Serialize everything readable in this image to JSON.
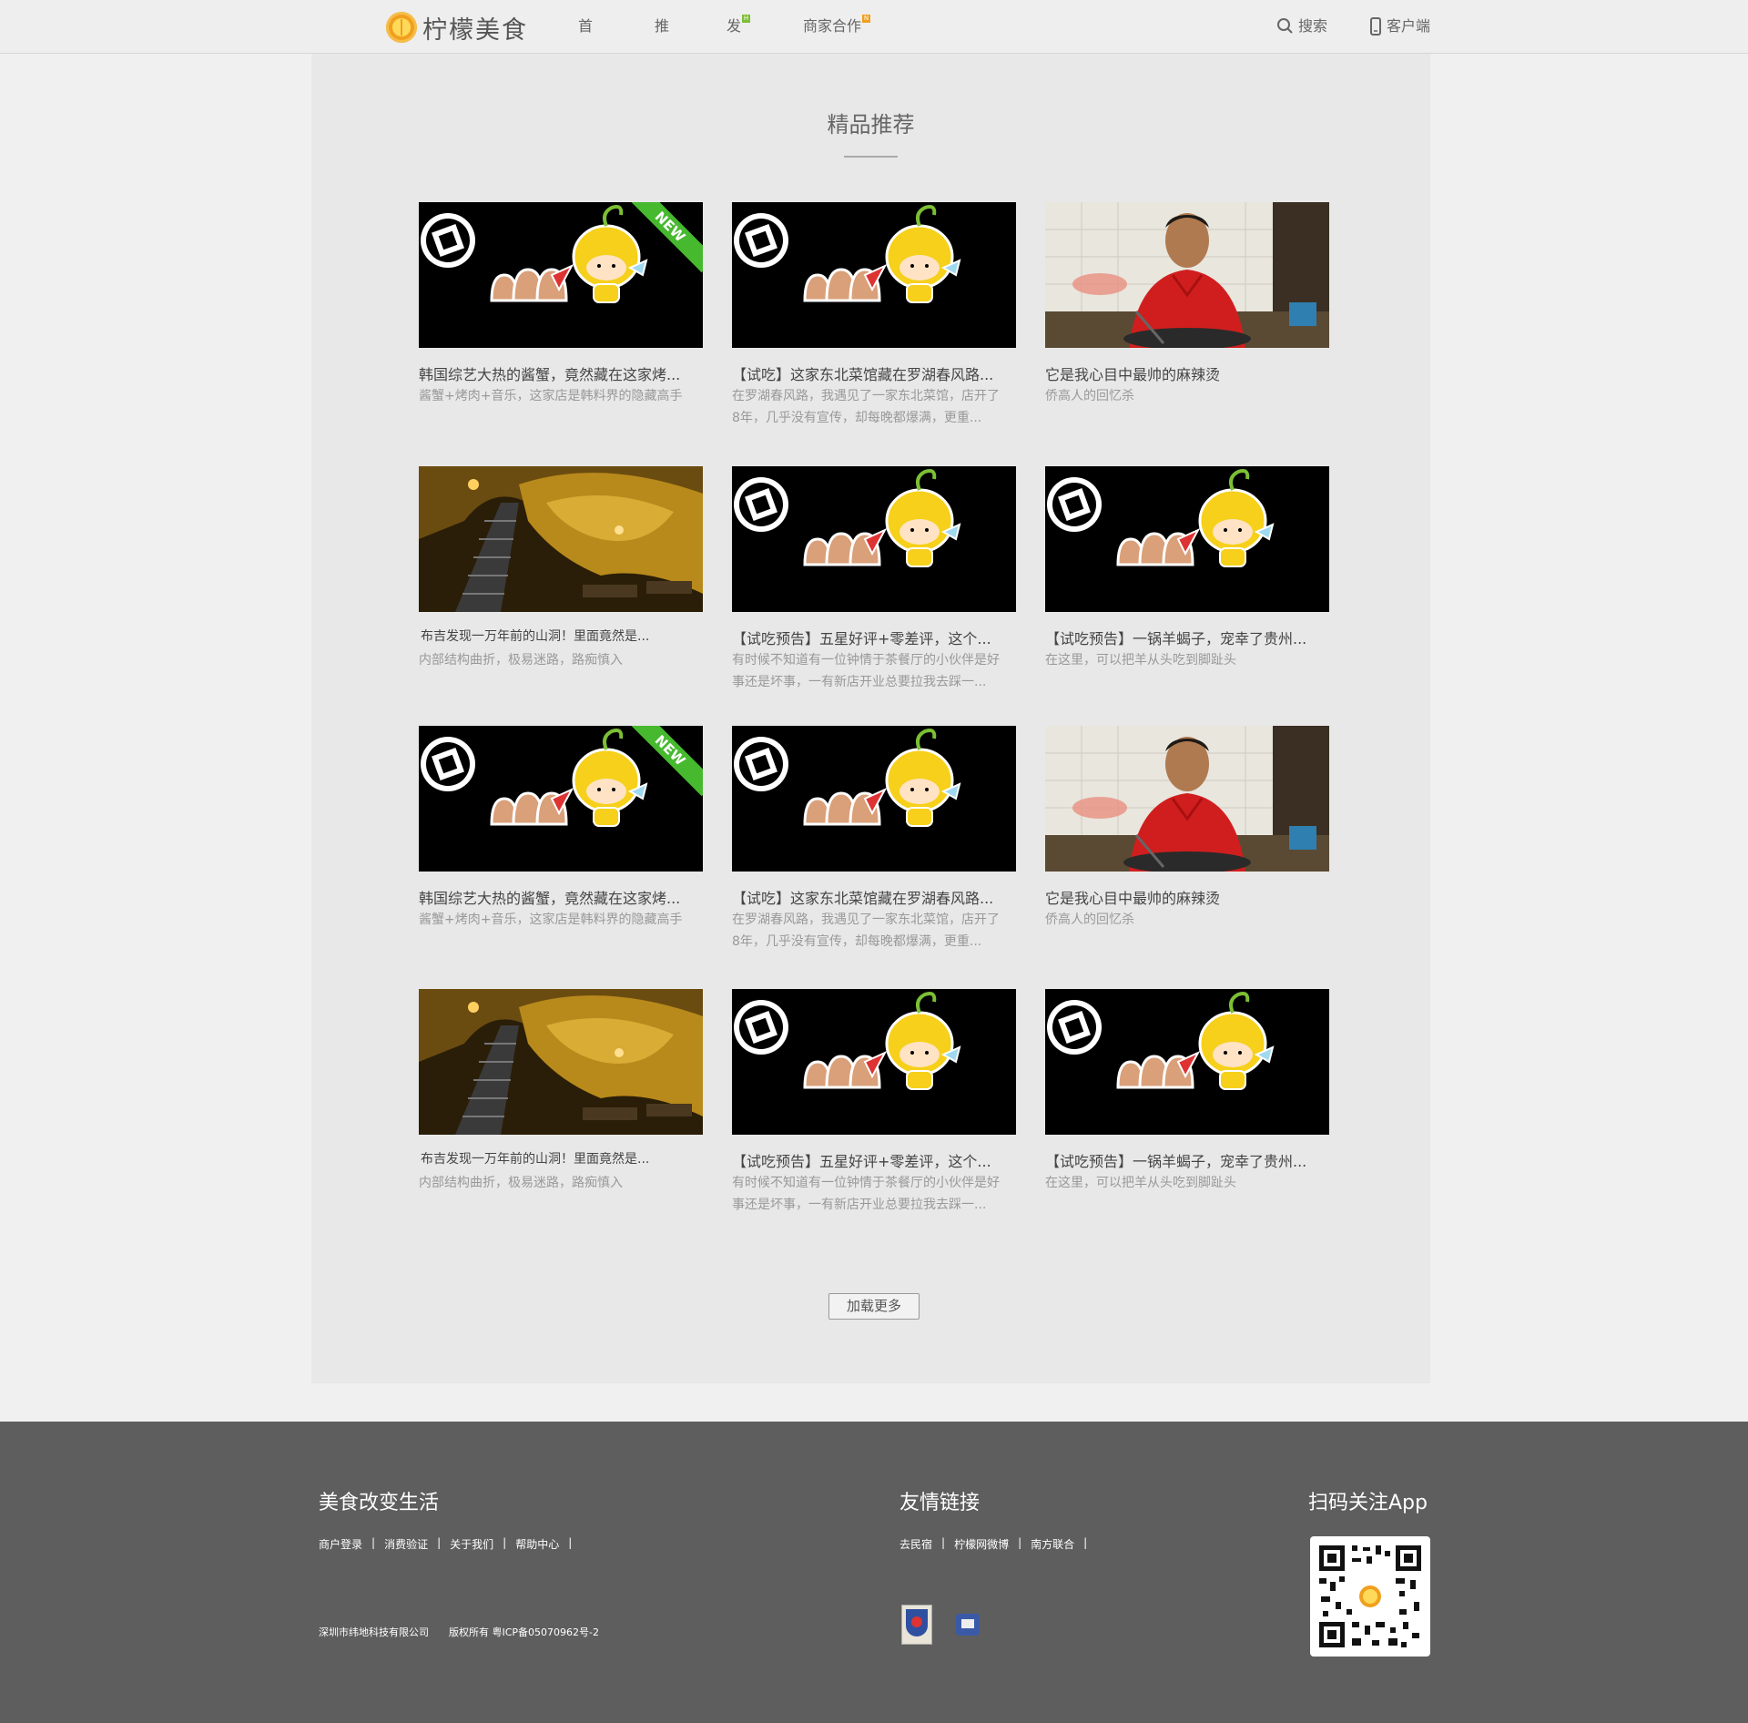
{
  "header": {
    "logo_text": "柠檬美食",
    "nav": [
      {
        "label": "首页",
        "badge": ""
      },
      {
        "label": "推荐",
        "badge": ""
      },
      {
        "label": "发现",
        "badge": "H",
        "badge_color": "#7cbf35"
      },
      {
        "label": "商家合作",
        "badge": "N",
        "badge_color": "#f0a01e"
      }
    ],
    "search_label": "搜索",
    "client_label": "客户端"
  },
  "main": {
    "section_title": "精品推荐",
    "cards": [
      {
        "thumb": "mascot",
        "new": true,
        "title": "韩国综艺大热的酱蟹，竟然藏在这家烤...",
        "desc": "酱蟹+烤肉+音乐，这家店是韩料界的隐藏高手"
      },
      {
        "thumb": "mascot",
        "new": false,
        "title": "【试吃】这家东北菜馆藏在罗湖春风路...",
        "desc": "在罗湖春风路，我遇见了一家东北菜馆，店开了8年，几乎没有宣传，却每晚都爆满，更重..."
      },
      {
        "thumb": "chef",
        "new": false,
        "title": "它是我心目中最帅的麻辣烫",
        "desc": "侨高人的回忆杀"
      },
      {
        "thumb": "cave",
        "new": false,
        "title": "布吉发现一万年前的山洞！里面竟然是...",
        "desc": "内部结构曲折，极易迷路，路痴慎入"
      },
      {
        "thumb": "mascot",
        "new": false,
        "title": "【试吃预告】五星好评+零差评，这个...",
        "desc": "有时候不知道有一位钟情于茶餐厅的小伙伴是好事还是坏事，一有新店开业总要拉我去踩一..."
      },
      {
        "thumb": "mascot",
        "new": false,
        "title": "【试吃预告】一锅羊蝎子，宠幸了贵州...",
        "desc": "在这里，可以把羊从头吃到脚趾头"
      },
      {
        "thumb": "mascot",
        "new": true,
        "title": "韩国综艺大热的酱蟹，竟然藏在这家烤...",
        "desc": "酱蟹+烤肉+音乐，这家店是韩料界的隐藏高手"
      },
      {
        "thumb": "mascot",
        "new": false,
        "title": "【试吃】这家东北菜馆藏在罗湖春风路...",
        "desc": "在罗湖春风路，我遇见了一家东北菜馆，店开了8年，几乎没有宣传，却每晚都爆满，更重..."
      },
      {
        "thumb": "chef",
        "new": false,
        "title": "它是我心目中最帅的麻辣烫",
        "desc": "侨高人的回忆杀"
      },
      {
        "thumb": "cave",
        "new": false,
        "title": "布吉发现一万年前的山洞！里面竟然是...",
        "desc": "内部结构曲折，极易迷路，路痴慎入"
      },
      {
        "thumb": "mascot",
        "new": false,
        "title": "【试吃预告】五星好评+零差评，这个...",
        "desc": "有时候不知道有一位钟情于茶餐厅的小伙伴是好事还是坏事，一有新店开业总要拉我去踩一..."
      },
      {
        "thumb": "mascot",
        "new": false,
        "title": "【试吃预告】一锅羊蝎子，宠幸了贵州...",
        "desc": "在这里，可以把羊从头吃到脚趾头"
      }
    ],
    "new_badge": "NEW",
    "load_more": "加载更多"
  },
  "footer": {
    "col1_title": "美食改变生活",
    "col1_links": [
      "商户登录",
      "消费验证",
      "关于我们",
      "帮助中心"
    ],
    "copyright": "深圳市纬地科技有限公司　　版权所有  粤ICP备05070962号-2",
    "col2_title": "友情链接",
    "col2_links": [
      "去民宿",
      "柠檬网微博",
      "南方联合"
    ],
    "col3_title": "扫码关注App"
  }
}
